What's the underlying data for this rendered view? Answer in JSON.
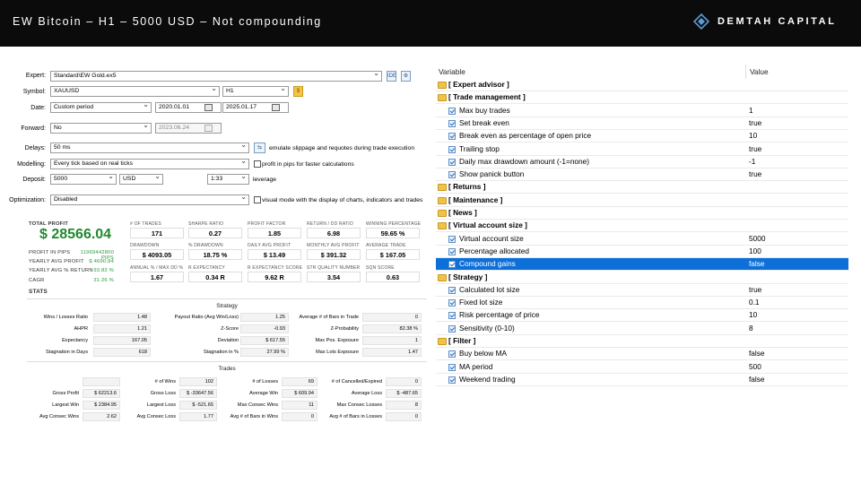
{
  "header": {
    "title": "EW Bitcoin – H1 – 5000 USD – Not compounding",
    "brand": "DEMTAH CAPITAL"
  },
  "settings": {
    "expert_label": "Expert:",
    "expert_value": "Standard\\EW Gold.ex5",
    "symbol_label": "Symbol:",
    "symbol_value": "XAUUSD",
    "timeframe": "H1",
    "date_label": "Date:",
    "date_mode": "Custom period",
    "date_from": "2020.01.01",
    "date_to": "2025.01.17",
    "forward_label": "Forward:",
    "forward_value": "No",
    "forward_date": "2023.06.24",
    "delays_label": "Delays:",
    "delays_value": "50 ms",
    "delays_note": "emulate slippage and requotes during trade execution",
    "modelling_label": "Modelling:",
    "modelling_value": "Every tick based on real ticks",
    "modelling_note": "profit in pips for faster calculations",
    "deposit_label": "Deposit:",
    "deposit_value": "5000",
    "currency": "USD",
    "leverage_value": "1:33",
    "leverage_label": "leverage",
    "optimization_label": "Optimization:",
    "optimization_value": "Disabled",
    "optimization_note": "visual mode with the display of charts, indicators and trades"
  },
  "summary": {
    "total_profit_label": "TOTAL PROFIT",
    "total_profit": "$ 28566.04",
    "profit_pips_label": "PROFIT IN PIPS",
    "profit_pips": "11969442800 PIPS",
    "yearly_profit_label": "YEARLY AVG PROFIT",
    "yearly_profit": "$ 4690.84",
    "yearly_return_label": "YEARLY AVG % RETURN",
    "yearly_return": "93.82 %",
    "cagr_label": "CAGR",
    "cagr": "31.26 %",
    "stats_label": "STATS"
  },
  "kpis": [
    {
      "label": "# OF TRADES",
      "value": "171"
    },
    {
      "label": "SHARPE RATIO",
      "value": "0.27"
    },
    {
      "label": "PROFIT FACTOR",
      "value": "1.85"
    },
    {
      "label": "RETURN / DD RATIO",
      "value": "6.98"
    },
    {
      "label": "WINNING PERCENTAGE",
      "value": "59.65 %"
    },
    {
      "label": "DRAWDOWN",
      "value": "$ 4093.05"
    },
    {
      "label": "% DRAWDOWN",
      "value": "18.75 %"
    },
    {
      "label": "DAILY AVG PROFIT",
      "value": "$ 13.49"
    },
    {
      "label": "MONTHLY AVG PROFIT",
      "value": "$ 391.32"
    },
    {
      "label": "AVERAGE TRADE",
      "value": "$ 167.05"
    },
    {
      "label": "ANNUAL % / MAX DD %",
      "value": "1.67"
    },
    {
      "label": "R EXPECTANCY",
      "value": "0.34 R"
    },
    {
      "label": "R EXPECTANCY SCORE",
      "value": "9.62 R"
    },
    {
      "label": "STR QUALITY NUMBER",
      "value": "3.54"
    },
    {
      "label": "SQN SCORE",
      "value": "0.63"
    }
  ],
  "strategy": {
    "title": "Strategy",
    "rows": [
      [
        [
          "Wins / Losses Ratio",
          "1.48"
        ],
        [
          "Payout Ratio (Avg Win/Loss)",
          "1.25"
        ],
        [
          "Average # of Bars in Trade",
          "0"
        ]
      ],
      [
        [
          "AHPR",
          "1.21"
        ],
        [
          "Z-Score",
          "-0.93"
        ],
        [
          "Z-Probability",
          "82.38 %"
        ]
      ],
      [
        [
          "Expectancy",
          "167.05"
        ],
        [
          "Deviation",
          "$ 617.55"
        ],
        [
          "Max Pos. Exposure",
          "1"
        ]
      ],
      [
        [
          "Stagnation in Days",
          "618"
        ],
        [
          "Stagnation in %",
          "27.99 %"
        ],
        [
          "Max Lots Exposure",
          "1.47"
        ]
      ]
    ]
  },
  "trades": {
    "title": "Trades",
    "rows": [
      [
        [
          "",
          ""
        ],
        [
          "# of Wins",
          "102"
        ],
        [
          "# of Losses",
          "69"
        ],
        [
          "# of Cancelled/Expired",
          "0"
        ]
      ],
      [
        [
          "Gross Profit",
          "$ 62213.6"
        ],
        [
          "Gross Loss",
          "$ -33647.56"
        ],
        [
          "Average Win",
          "$ 609.94"
        ],
        [
          "Average Loss",
          "$ -487.65"
        ]
      ],
      [
        [
          "Largest Win",
          "$ 2384.95"
        ],
        [
          "Largest Loss",
          "$ -521.65"
        ],
        [
          "Max Consec Wins",
          "11"
        ],
        [
          "Max Consec Losses",
          "8"
        ]
      ],
      [
        [
          "Avg Consec Wins",
          "2.62"
        ],
        [
          "Avg Consec Loss",
          "1.77"
        ],
        [
          "Avg # of Bars in Wins",
          "0"
        ],
        [
          "Avg # of Bars in Losses",
          "0"
        ]
      ]
    ]
  },
  "params": {
    "col_variable": "Variable",
    "col_value": "Value",
    "rows": [
      {
        "type": "group",
        "label": "[ Expert advisor ]",
        "value": ""
      },
      {
        "type": "group",
        "label": "[ Trade management ]",
        "value": ""
      },
      {
        "type": "item",
        "label": "Max buy trades",
        "value": "1"
      },
      {
        "type": "item",
        "label": "Set break even",
        "value": "true"
      },
      {
        "type": "item",
        "label": "Break even as percentage of open price",
        "value": "10"
      },
      {
        "type": "item",
        "label": "Trailing stop",
        "value": "true"
      },
      {
        "type": "item",
        "label": "Daily max drawdown amount (-1=none)",
        "value": "-1"
      },
      {
        "type": "item",
        "label": "Show panick button",
        "value": "true"
      },
      {
        "type": "group",
        "label": "[ Returns ]",
        "value": ""
      },
      {
        "type": "group",
        "label": "[ Maintenance ]",
        "value": ""
      },
      {
        "type": "group",
        "label": "[ News ]",
        "value": ""
      },
      {
        "type": "group",
        "label": "[ Virtual account size ]",
        "value": ""
      },
      {
        "type": "item",
        "label": "Virtual account size",
        "value": "5000"
      },
      {
        "type": "item",
        "label": "Percentage allocated",
        "value": "100"
      },
      {
        "type": "item",
        "label": "Compound gains",
        "value": "false",
        "selected": true
      },
      {
        "type": "group",
        "label": "[ Strategy ]",
        "value": ""
      },
      {
        "type": "item",
        "label": "Calculated lot size",
        "value": "true"
      },
      {
        "type": "item",
        "label": "Fixed lot size",
        "value": "0.1"
      },
      {
        "type": "item",
        "label": "Risk percentage of price",
        "value": "10"
      },
      {
        "type": "item",
        "label": "Sensitivity (0-10)",
        "value": "8"
      },
      {
        "type": "group",
        "label": "[ Filter ]",
        "value": ""
      },
      {
        "type": "item",
        "label": "Buy below MA",
        "value": "false"
      },
      {
        "type": "item",
        "label": "MA period",
        "value": "500"
      },
      {
        "type": "item",
        "label": "Weekend trading",
        "value": "false"
      }
    ]
  }
}
